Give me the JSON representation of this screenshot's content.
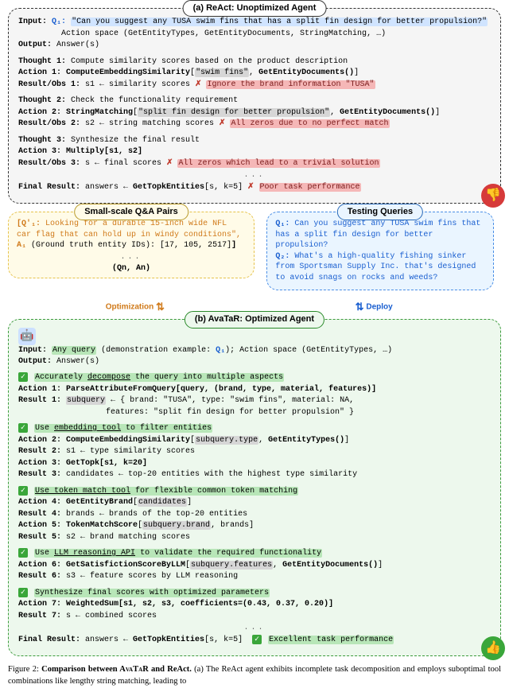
{
  "panelA": {
    "title": "(a) ReAct: Unoptimized Agent",
    "inputLabel": "Input:",
    "inputQ": "Q₁:",
    "inputText": "\"Can you suggest any TUSA swim fins that has a split fin design for better propulsion?\"",
    "actionSpace": "Action space (GetEntityTypes, GetEntityDocuments, StringMatching, …)",
    "outputLabel": "Output:",
    "outputText": "Answer(s)",
    "t1": "Thought 1:",
    "t1text": "Compute similarity scores based on the product description",
    "a1": "Action 1: ComputeEmbeddingSimilarity",
    "a1arg1": "\"swim fins\"",
    "a1arg2": "GetEntityDocuments()",
    "r1": "Result/Obs 1:",
    "r1text": "s1 ← similarity scores",
    "r1err": "Ignore the brand information \"TUSA\"",
    "t2": "Thought 2:",
    "t2text": "Check the functionality requirement",
    "a2": "Action 2: StringMatching",
    "a2arg1": "\"split fin design for better propulsion\"",
    "a2arg2": "GetEntityDocuments()",
    "r2": "Result/Obs 2:",
    "r2text": "s2 ← string matching scores",
    "r2err": "All zeros due to no perfect match",
    "t3": "Thought 3:",
    "t3text": "Synthesize the final result",
    "a3": "Action 3: Multiply[s1, s2]",
    "r3": "Result/Obs 3:",
    "r3text": "s ← final scores",
    "r3err": "All zeros which lead to a trivial solution",
    "dots": "...",
    "final": "Final Result:",
    "finalText": "answers ← GetTopkEntities[s, k=5]",
    "finalErr": "Poor task performance"
  },
  "qa": {
    "title": "Small-scale Q&A Pairs",
    "q": "[Q'₁:",
    "qtext": "Looking for a durable 15-inch wide NFL car flag that can hold up in windy conditions\",",
    "a": "A₁",
    "atext": "(Ground truth entity IDs): [17, 105, 2517]",
    "pair": "(Qn, An)",
    "dots": "..."
  },
  "tq": {
    "title": "Testing Queries",
    "q1": "Q₁:",
    "q1text": "Can you suggest any TUSA swim fins that has a split fin design for better propulsion?",
    "q2": "Q₂:",
    "q2text": "What's a high-quality fishing sinker from Sportsman Supply Inc. that's designed to avoid snags on rocks and weeds?"
  },
  "connectors": {
    "opt": "Optimization",
    "dep": "Deploy"
  },
  "panelB": {
    "title": "(b) AvaTaR: Optimized Agent",
    "inputLabel": "Input:",
    "inputQuery": "Any query",
    "inputDemo": "(demonstration example: Q₁); Action space (GetEntityTypes, …)",
    "outputLabel": "Output:",
    "outputText": "Answer(s)",
    "h1": "Accurately decompose the query into multiple aspects",
    "a1": "Action 1: ParseAttributeFromQuery[query, (brand, type, material, features)]",
    "r1": "Result 1:",
    "r1sub": "subquery",
    "r1text": "← {   brand: \"TUSA\", type: \"swim fins\", material: NA,",
    "r1text2": "features: \"split fin design for better propulsion\"   }",
    "h2": "Use embedding tool to filter entities",
    "a2": "Action 2: ComputeEmbeddingSimilarity",
    "a2arg1": "subquery.type",
    "a2arg2": "GetEntityTypes()",
    "r2": "Result 2:",
    "r2text": "s1 ← type similarity scores",
    "a3": "Action 3: GetTopk[s1, k=20]",
    "r3": "Result 3:",
    "r3text": "candidates ← top-20 entities with the highest type similarity",
    "h3": "Use token match tool for flexible common token matching",
    "a4": "Action 4: GetEntityBrand",
    "a4arg": "candidates",
    "r4": "Result 4:",
    "r4text": "brands ← brands of the top-20 entities",
    "a5": "Action 5: TokenMatchScore",
    "a5arg": "subquery.brand",
    "a5arg2": "brands",
    "r5": "Result 5:",
    "r5text": "s2 ← brand matching scores",
    "h4": "Use LLM reasoning API to validate the required functionality",
    "a6": "Action 6: GetSatisfictionScoreByLLM",
    "a6arg": "subquery.features",
    "a6arg2": "GetEntityDocuments()",
    "r6": "Result 6:",
    "r6text": "s3 ← feature scores by LLM reasoning",
    "h5": "Synthesize final scores with optimized parameters",
    "a7": "Action 7: WeightedSum[s1, s2, s3, coefficients=(0.43, 0.37, 0.20)]",
    "r7": "Result 7:",
    "r7text": "s ← combined scores",
    "dots": "...",
    "final": "Final Result:",
    "finalText": "answers ← GetTopkEntities[s, k=5]",
    "finalOk": "Excellent task performance"
  },
  "caption": {
    "lead": "Figure 2: ",
    "boldpart": "Comparison between AVATAR and ReAct.",
    "rest": " (a) The ReAct agent exhibits incomplete task decomposition and employs suboptimal tool combinations like lengthy string matching, leading to"
  }
}
